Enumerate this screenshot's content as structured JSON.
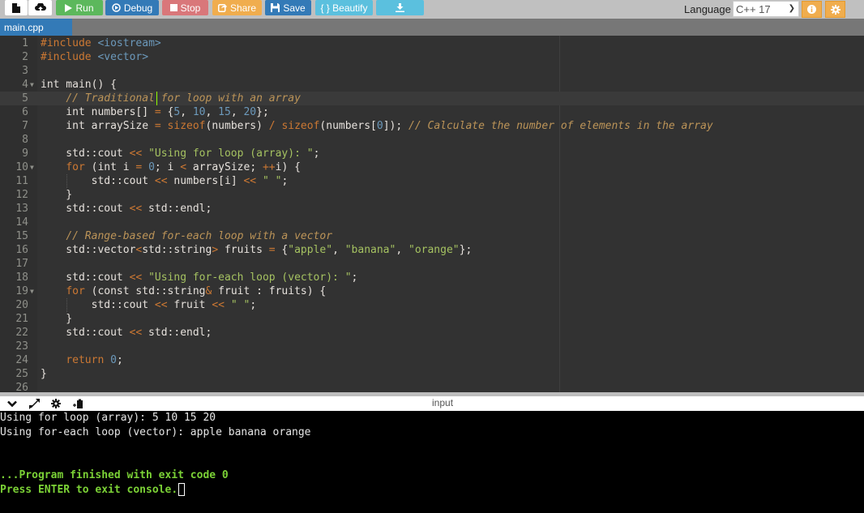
{
  "toolbar": {
    "new_file_icon": "file-icon",
    "upload_icon": "upload-icon",
    "run_label": "Run",
    "debug_label": "Debug",
    "stop_label": "Stop",
    "share_label": "Share",
    "save_label": "Save",
    "beautify_label": "{ } Beautify",
    "download_icon": "download-icon",
    "language_label": "Language",
    "language_selected": "C++ 17",
    "colors": {
      "run": "#5cb85c",
      "debug": "#337ab7",
      "stop": "#d9777a",
      "share": "#f0ad4e",
      "save": "#337ab7",
      "beautify": "#5bc0de"
    }
  },
  "tabs": [
    {
      "label": "main.cpp",
      "active": true
    }
  ],
  "editor": {
    "active_line": 5,
    "lines": [
      {
        "n": "1",
        "text": "#include <iostream>"
      },
      {
        "n": "2",
        "text": "#include <vector>"
      },
      {
        "n": "3",
        "text": ""
      },
      {
        "n": "4",
        "text": "int main() {",
        "fold": true
      },
      {
        "n": "5",
        "text": "    // Traditional for loop with an array"
      },
      {
        "n": "6",
        "text": "    int numbers[] = {5, 10, 15, 20};"
      },
      {
        "n": "7",
        "text": "    int arraySize = sizeof(numbers) / sizeof(numbers[0]); // Calculate the number of elements in the array"
      },
      {
        "n": "8",
        "text": ""
      },
      {
        "n": "9",
        "text": "    std::cout << \"Using for loop (array): \";"
      },
      {
        "n": "10",
        "text": "    for (int i = 0; i < arraySize; ++i) {",
        "fold": true
      },
      {
        "n": "11",
        "text": "        std::cout << numbers[i] << \" \";"
      },
      {
        "n": "12",
        "text": "    }"
      },
      {
        "n": "13",
        "text": "    std::cout << std::endl;"
      },
      {
        "n": "14",
        "text": ""
      },
      {
        "n": "15",
        "text": "    // Range-based for-each loop with a vector"
      },
      {
        "n": "16",
        "text": "    std::vector<std::string> fruits = {\"apple\", \"banana\", \"orange\"};"
      },
      {
        "n": "17",
        "text": ""
      },
      {
        "n": "18",
        "text": "    std::cout << \"Using for-each loop (vector): \";"
      },
      {
        "n": "19",
        "text": "    for (const std::string& fruit : fruits) {",
        "fold": true
      },
      {
        "n": "20",
        "text": "        std::cout << fruit << \" \";"
      },
      {
        "n": "21",
        "text": "    }"
      },
      {
        "n": "22",
        "text": "    std::cout << std::endl;"
      },
      {
        "n": "23",
        "text": ""
      },
      {
        "n": "24",
        "text": "    return 0;"
      },
      {
        "n": "25",
        "text": "}"
      },
      {
        "n": "26",
        "text": ""
      }
    ]
  },
  "console_bar": {
    "collapse_icon": "chevron-down-icon",
    "expand_icon": "expand-icon",
    "settings_icon": "gear-icon",
    "clipboard_icon": "paste-icon",
    "input_label": "input"
  },
  "console": {
    "lines": [
      {
        "text": "Using for loop (array): 5 10 15 20",
        "style": "normal"
      },
      {
        "text": "Using for-each loop (vector): apple banana orange",
        "style": "normal"
      },
      {
        "text": "",
        "style": "normal"
      },
      {
        "text": "",
        "style": "normal"
      },
      {
        "text": "...Program finished with exit code 0",
        "style": "green"
      },
      {
        "text": "Press ENTER to exit console.",
        "style": "green"
      }
    ]
  }
}
